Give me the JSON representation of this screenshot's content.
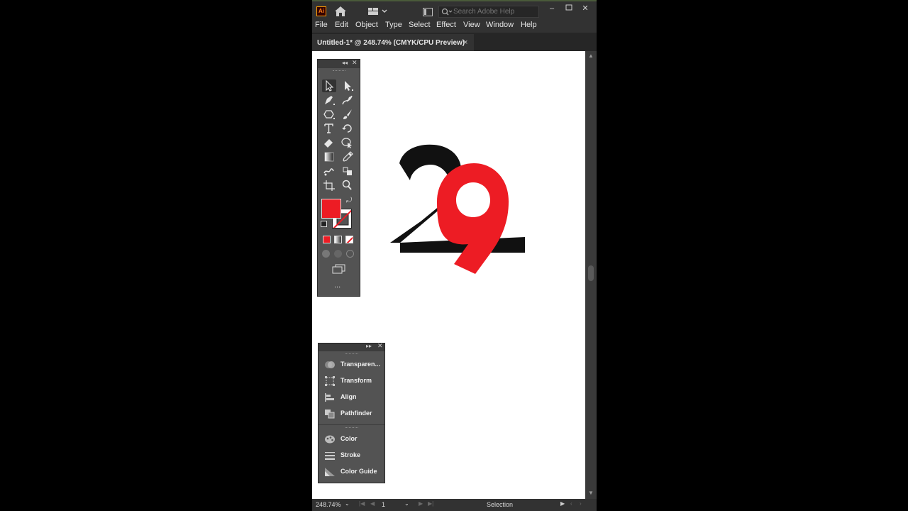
{
  "titlebar": {
    "app_logo": "Ai",
    "search_placeholder": "Search Adobe Help",
    "icons": [
      "home-icon",
      "workspace-switcher-icon",
      "search-icon"
    ]
  },
  "menu": [
    "File",
    "Edit",
    "Object",
    "Type",
    "Select",
    "Effect",
    "View",
    "Window",
    "Help"
  ],
  "document_tab": {
    "title": "Untitled-1* @ 248.74% (CMYK/CPU Preview)",
    "close": "×"
  },
  "artwork": {
    "digit_back": "2",
    "digit_front": "9",
    "back_color": "#111111",
    "front_color": "#ed1c24"
  },
  "toolbar": {
    "fill_color": "#ed1c24",
    "stroke": "none",
    "tools": [
      "selection-tool",
      "direct-selection-tool",
      "pen-tool",
      "curvature-tool",
      "shape-tool",
      "paintbrush-tool",
      "type-tool",
      "rotate-tool",
      "eraser-tool",
      "shape-builder-tool",
      "gradient-tool",
      "eyedropper-tool",
      "puppet-warp-tool",
      "symbol-sprayer-tool",
      "artboard-tool",
      "zoom-tool"
    ],
    "more": "..."
  },
  "properties_panel": {
    "group1": [
      {
        "label": "Transparen...",
        "icon": "transparency-icon"
      },
      {
        "label": "Transform",
        "icon": "transform-icon"
      },
      {
        "label": "Align",
        "icon": "align-icon"
      },
      {
        "label": "Pathfinder",
        "icon": "pathfinder-icon"
      }
    ],
    "group2": [
      {
        "label": "Color",
        "icon": "color-icon"
      },
      {
        "label": "Stroke",
        "icon": "stroke-icon"
      },
      {
        "label": "Color Guide",
        "icon": "color-guide-icon"
      }
    ]
  },
  "statusbar": {
    "zoom": "248.74%",
    "artboard": "1",
    "current_tool": "Selection"
  }
}
